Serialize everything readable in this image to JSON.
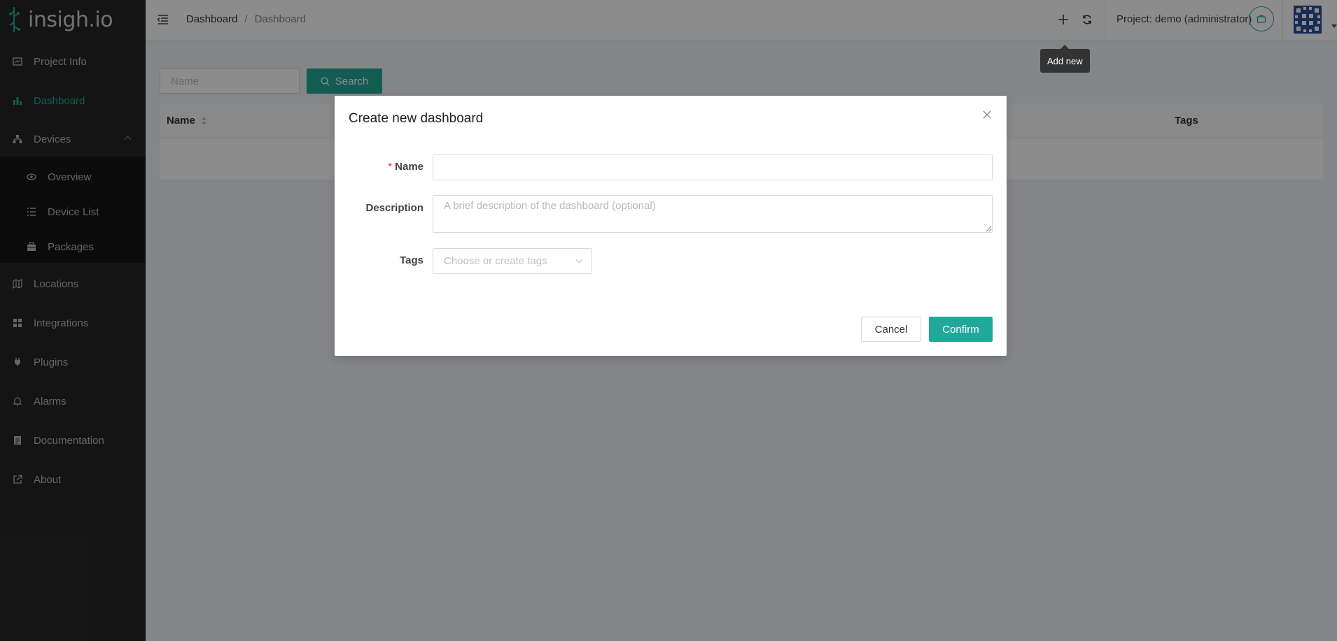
{
  "app": {
    "logo_text": "insigh.io"
  },
  "sidebar": {
    "items": [
      {
        "label": "Project Info",
        "icon": "project-info-icon"
      },
      {
        "label": "Dashboard",
        "icon": "bar-chart-icon"
      },
      {
        "label": "Devices",
        "icon": "sitemap-icon"
      },
      {
        "label": "Locations",
        "icon": "map-icon"
      },
      {
        "label": "Integrations",
        "icon": "appstore-icon"
      },
      {
        "label": "Plugins",
        "icon": "plug-icon"
      },
      {
        "label": "Alarms",
        "icon": "bell-icon"
      },
      {
        "label": "Documentation",
        "icon": "document-icon"
      },
      {
        "label": "About",
        "icon": "external-link-icon"
      }
    ],
    "devices_submenu": [
      {
        "label": "Overview",
        "icon": "eye-icon"
      },
      {
        "label": "Device List",
        "icon": "list-icon"
      },
      {
        "label": "Packages",
        "icon": "package-icon"
      }
    ],
    "active_item": "Dashboard"
  },
  "header": {
    "breadcrumb": [
      "Dashboard",
      "Dashboard"
    ],
    "breadcrumb_separator": "/",
    "project_label": "Project: demo (administrator)",
    "add_tooltip": "Add new"
  },
  "content": {
    "search_placeholder": "Name",
    "search_button": "Search",
    "table_columns": [
      "Name",
      "Tags"
    ]
  },
  "modal": {
    "title": "Create new dashboard",
    "name_label": "Name",
    "name_value": "",
    "description_label": "Description",
    "description_placeholder": "A brief description of the dashboard (optional)",
    "tags_label": "Tags",
    "tags_placeholder": "Choose or create tags",
    "cancel_label": "Cancel",
    "confirm_label": "Confirm"
  },
  "colors": {
    "accent": "#22a89a",
    "sidebar_bg": "#262626",
    "submenu_bg": "#141414",
    "required": "#f5222d",
    "overlay": "rgba(0,0,0,0.45)"
  }
}
